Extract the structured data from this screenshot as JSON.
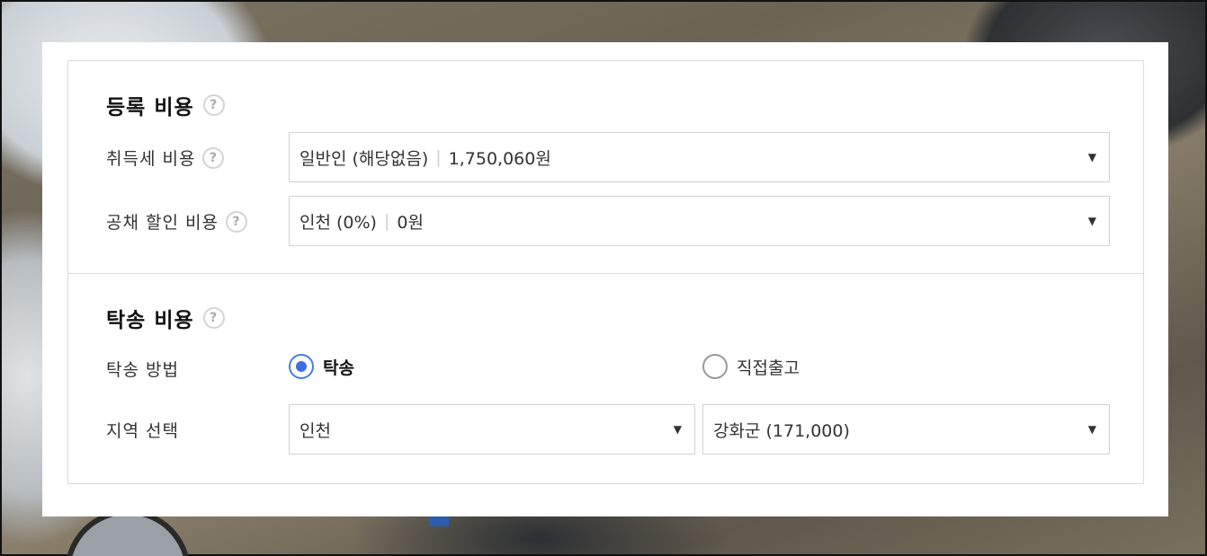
{
  "registration": {
    "title": "등록 비용",
    "help": "?",
    "acquisition_tax": {
      "label": "취득세 비용",
      "help": "?",
      "value_type": "일반인 (해당없음)",
      "separator": "|",
      "value_amount": "1,750,060원",
      "arrow": "▼"
    },
    "bond_discount": {
      "label": "공채 할인 비용",
      "help": "?",
      "value_region": "인천 (0%)",
      "separator": "|",
      "value_amount": "0원",
      "arrow": "▼"
    }
  },
  "towing": {
    "title": "탁송 비용",
    "help": "?",
    "method": {
      "label": "탁송 방법",
      "options": [
        {
          "label": "탁송",
          "checked": true
        },
        {
          "label": "직접출고",
          "checked": false
        }
      ]
    },
    "region": {
      "label": "지역 선택",
      "city": "인천",
      "district": "강화군 (171,000)",
      "arrow": "▼"
    }
  },
  "colors": {
    "accent": "#3d6fdc",
    "border": "#dcdcdc"
  }
}
